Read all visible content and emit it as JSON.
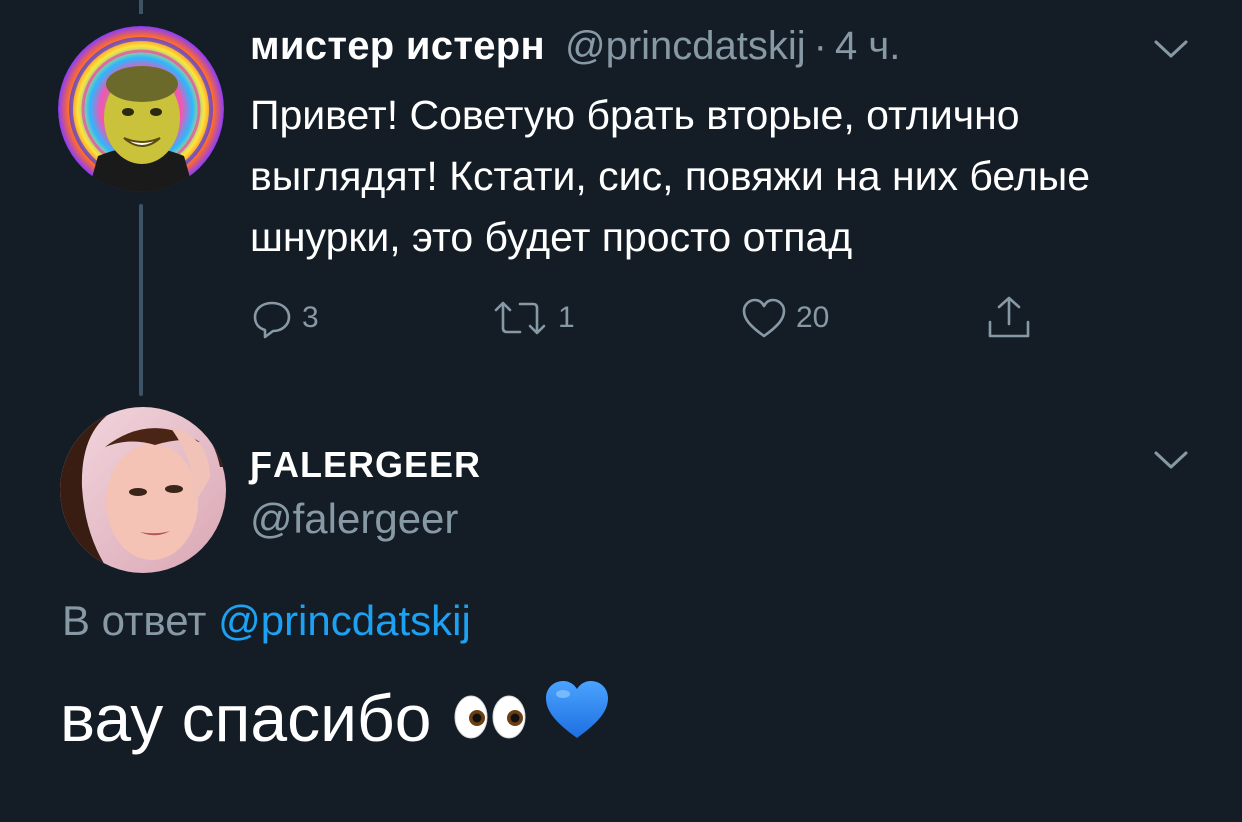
{
  "original_tweet": {
    "author_name": "мистер истерн",
    "author_handle": "@princdatskij",
    "separator": "·",
    "timestamp": "4 ч.",
    "text": "Привет! Советую брать вторые, отлично выглядят! Кстати, сис, повяжи на них белые шнурки, это будет просто отпад",
    "actions": {
      "reply_count": "3",
      "retweet_count": "1",
      "like_count": "20"
    }
  },
  "reply_tweet": {
    "author_name": "ƑALERGEER",
    "author_handle": "@falergeer",
    "in_reply_to_prefix": "В ответ",
    "in_reply_to_handle": "@princdatskij",
    "text": "вау спасибо",
    "emojis": [
      "eyes-emoji",
      "blue-heart-emoji"
    ]
  },
  "colors": {
    "background": "#141d26",
    "secondary_text": "#8899a6",
    "mention": "#1da1f2",
    "thread_line": "#3d5466"
  }
}
